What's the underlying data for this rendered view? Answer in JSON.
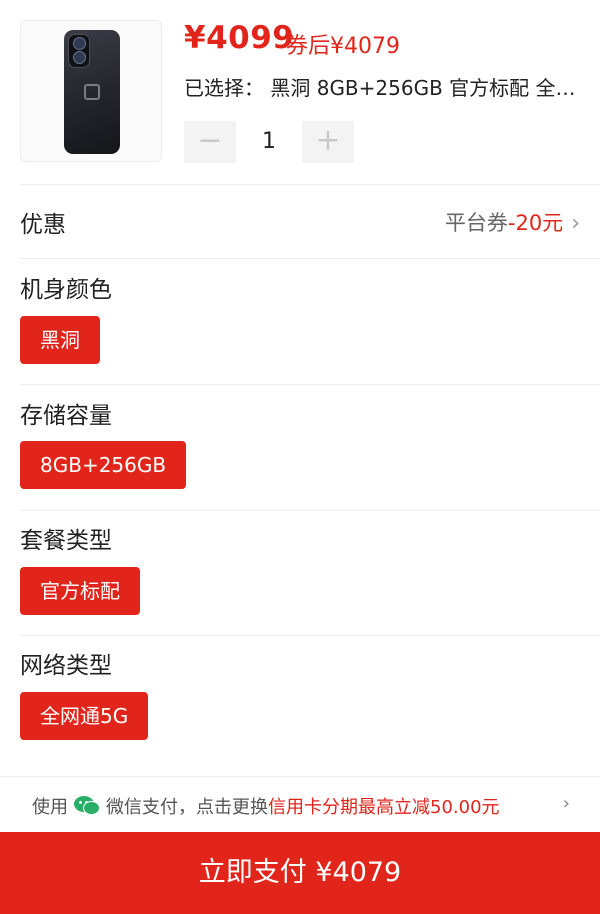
{
  "product": {
    "price": "¥4099",
    "coupon_price": "券后¥4079",
    "selected_text": "已选择： 黑洞 8GB+256GB 官方标配 全…",
    "quantity": "1",
    "minus_symbol": "−",
    "plus_symbol": "+"
  },
  "promo": {
    "label": "优惠",
    "platform_coupon": "平台券",
    "amount": "-20元",
    "chevron": "›"
  },
  "options": [
    {
      "title": "机身颜色",
      "selected": "黑洞"
    },
    {
      "title": "存储容量",
      "selected": "8GB+256GB"
    },
    {
      "title": "套餐类型",
      "selected": "官方标配"
    },
    {
      "title": "网络类型",
      "selected": "全网通5G"
    }
  ],
  "payment_hint": {
    "use": "使用",
    "method": "微信支付，点击更换",
    "offer": "信用卡分期最高立减50.00元",
    "chevron": "›"
  },
  "pay_button": {
    "label": "立即支付 ¥4079"
  },
  "colors": {
    "accent": "#e1251b",
    "wechat_green": "#2aae67"
  }
}
